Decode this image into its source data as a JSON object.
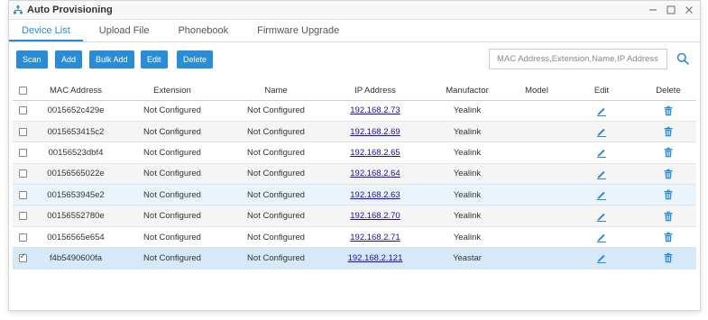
{
  "window": {
    "title": "Auto Provisioning"
  },
  "tabs": [
    {
      "label": "Device List",
      "active": true
    },
    {
      "label": "Upload File"
    },
    {
      "label": "Phonebook"
    },
    {
      "label": "Firmware Upgrade"
    }
  ],
  "toolbar": {
    "scan": "Scan",
    "add": "Add",
    "bulk_add": "Bulk Add",
    "edit": "Edit",
    "delete": "Delete",
    "search_placeholder": "MAC Address,Extension,Name,IP Address"
  },
  "table": {
    "headers": [
      "MAC Address",
      "Extension",
      "Name",
      "IP Address",
      "Manufactor",
      "Model",
      "Edit",
      "Delete"
    ],
    "rows": [
      {
        "mac": "0015652c429e",
        "extension": "Not Configured",
        "name": "Not Configured",
        "ip": "192.168.2.73",
        "manufactor": "Yealink",
        "model": "",
        "checked": false
      },
      {
        "mac": "0015653415c2",
        "extension": "Not Configured",
        "name": "Not Configured",
        "ip": "192.168.2.69",
        "manufactor": "Yealink",
        "model": "",
        "checked": false
      },
      {
        "mac": "00156523dbf4",
        "extension": "Not Configured",
        "name": "Not Configured",
        "ip": "192.168.2.65",
        "manufactor": "Yealink",
        "model": "",
        "checked": false
      },
      {
        "mac": "00156565022e",
        "extension": "Not Configured",
        "name": "Not Configured",
        "ip": "192.168.2.64",
        "manufactor": "Yealink",
        "model": "",
        "checked": false
      },
      {
        "mac": "0015653945e2",
        "extension": "Not Configured",
        "name": "Not Configured",
        "ip": "192.168.2.63",
        "manufactor": "Yealink",
        "model": "",
        "checked": false
      },
      {
        "mac": "00156552780e",
        "extension": "Not Configured",
        "name": "Not Configured",
        "ip": "192.168.2.70",
        "manufactor": "Yealink",
        "model": "",
        "checked": false
      },
      {
        "mac": "00156565e654",
        "extension": "Not Configured",
        "name": "Not Configured",
        "ip": "192.168.2.71",
        "manufactor": "Yealink",
        "model": "",
        "checked": false
      },
      {
        "mac": "f4b5490600fa",
        "extension": "Not Configured",
        "name": "Not Configured",
        "ip": "192.168.2.121",
        "manufactor": "Yeastar",
        "model": "",
        "checked": true
      }
    ]
  },
  "colors": {
    "accent": "#2b8cd6",
    "link": "#1a0dab",
    "selected_row": "#d6e9f8",
    "hover_row": "#eaf4fc"
  },
  "icons": {
    "app": "network-icon",
    "search": "search-icon",
    "edit": "pencil-icon",
    "delete": "trash-icon"
  }
}
